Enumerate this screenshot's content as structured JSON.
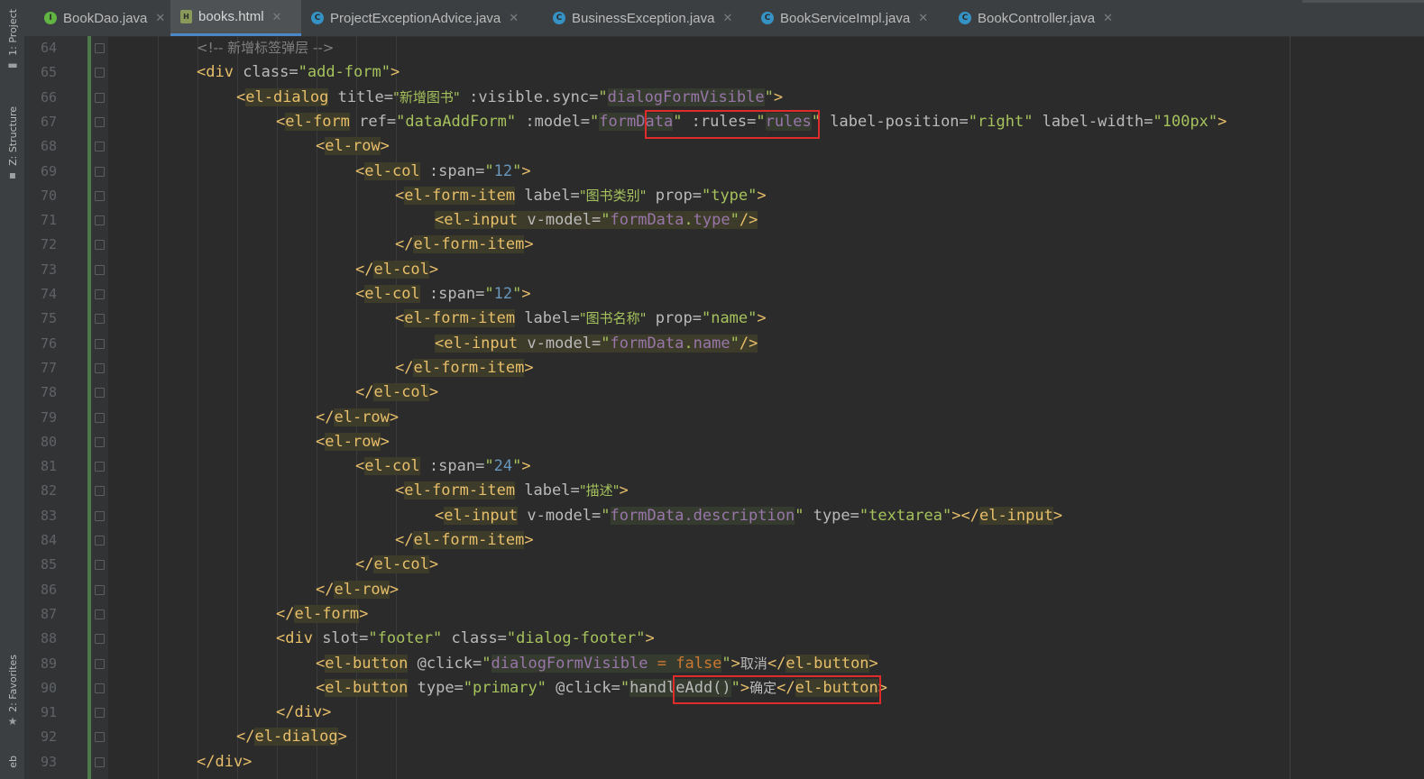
{
  "left_toolstrip": {
    "project": "1: Project",
    "structure": "Z: Structure",
    "favorites": "2: Favorites",
    "web": "eb"
  },
  "tabs": [
    {
      "label": "BookDao.java",
      "icon": "I",
      "icon_name": "interface-icon",
      "active": false
    },
    {
      "label": "books.html",
      "icon": "H",
      "icon_name": "html-file-icon",
      "active": true
    },
    {
      "label": "ProjectExceptionAdvice.java",
      "icon": "C",
      "icon_name": "class-icon",
      "active": false
    },
    {
      "label": "BusinessException.java",
      "icon": "C",
      "icon_name": "class-icon",
      "active": false
    },
    {
      "label": "BookServiceImpl.java",
      "icon": "C",
      "icon_name": "class-icon",
      "active": false
    },
    {
      "label": "BookController.java",
      "icon": "C",
      "icon_name": "class-icon",
      "active": false
    }
  ],
  "tab_close_glyph": "✕",
  "editor": {
    "line_numbers": [
      "64",
      "65",
      "66",
      "67",
      "68",
      "69",
      "70",
      "71",
      "72",
      "73",
      "74",
      "75",
      "76",
      "77",
      "78",
      "79",
      "80",
      "81",
      "82",
      "83",
      "84",
      "85",
      "86",
      "87",
      "88",
      "89",
      "90",
      "91",
      "92",
      "93"
    ],
    "lines": [
      {
        "indent": 0,
        "parts": [
          [
            "com",
            "<!-- 新增标签弹层 -->"
          ]
        ]
      },
      {
        "indent": 0,
        "parts": [
          [
            "tag",
            "<div "
          ],
          [
            "attr",
            "class="
          ],
          [
            "str",
            "\"add-form\""
          ],
          [
            "tag",
            ">"
          ]
        ]
      },
      {
        "indent": 1,
        "parts": [
          [
            "tag",
            "<"
          ],
          [
            "tag",
            "el-dialog",
            "hl"
          ],
          [
            "attr",
            " title="
          ],
          [
            "str",
            "\"新增图书\""
          ],
          [
            "attr",
            " :visible.sync="
          ],
          [
            "str",
            "\""
          ],
          [
            "var",
            "dialogFormVisible",
            "hl2"
          ],
          [
            "str",
            "\""
          ],
          [
            "tag",
            ">"
          ]
        ]
      },
      {
        "indent": 2,
        "parts": [
          [
            "tag",
            "<"
          ],
          [
            "tag",
            "el-form",
            "hl"
          ],
          [
            "attr",
            " ref="
          ],
          [
            "str",
            "\"dataAddForm\""
          ],
          [
            "attr",
            " :model="
          ],
          [
            "str",
            "\""
          ],
          [
            "var",
            "formData",
            "hl2"
          ],
          [
            "str",
            "\""
          ],
          [
            "attr",
            " :rules="
          ],
          [
            "str",
            "\""
          ],
          [
            "var",
            "rules",
            "hl2"
          ],
          [
            "str",
            "\""
          ],
          [
            "attr",
            " label-position="
          ],
          [
            "str",
            "\"right\""
          ],
          [
            "attr",
            " label-width="
          ],
          [
            "str",
            "\"100px\""
          ],
          [
            "tag",
            ">"
          ]
        ]
      },
      {
        "indent": 3,
        "parts": [
          [
            "tag",
            "<"
          ],
          [
            "tag",
            "el-row",
            "hl"
          ],
          [
            "tag",
            ">"
          ]
        ]
      },
      {
        "indent": 4,
        "parts": [
          [
            "tag",
            "<"
          ],
          [
            "tag",
            "el-col",
            "hl"
          ],
          [
            "attr",
            " :span="
          ],
          [
            "str",
            "\""
          ],
          [
            "num",
            "12"
          ],
          [
            "str",
            "\""
          ],
          [
            "tag",
            ">"
          ]
        ]
      },
      {
        "indent": 5,
        "parts": [
          [
            "tag",
            "<"
          ],
          [
            "tag",
            "el-form-item",
            "hl"
          ],
          [
            "attr",
            " label="
          ],
          [
            "str",
            "\"图书类别\""
          ],
          [
            "attr",
            " prop="
          ],
          [
            "str",
            "\"type\""
          ],
          [
            "tag",
            ">"
          ]
        ]
      },
      {
        "indent": 6,
        "parts": [
          [
            "tag",
            "<el-input",
            "hl"
          ],
          [
            "attr",
            " v-model=",
            "hl"
          ],
          [
            "str",
            "\"",
            "hl"
          ],
          [
            "var",
            "formData",
            "hl"
          ],
          [
            "str",
            ".",
            "hl"
          ],
          [
            "var",
            "type",
            "hl"
          ],
          [
            "str",
            "\"",
            "hl"
          ],
          [
            "tag",
            "/>",
            "hl"
          ]
        ]
      },
      {
        "indent": 5,
        "parts": [
          [
            "tag",
            "</"
          ],
          [
            "tag",
            "el-form-item",
            "hl"
          ],
          [
            "tag",
            ">"
          ]
        ]
      },
      {
        "indent": 4,
        "parts": [
          [
            "tag",
            "</"
          ],
          [
            "tag",
            "el-col",
            "hl"
          ],
          [
            "tag",
            ">"
          ]
        ]
      },
      {
        "indent": 4,
        "parts": [
          [
            "tag",
            "<"
          ],
          [
            "tag",
            "el-col",
            "hl"
          ],
          [
            "attr",
            " :span="
          ],
          [
            "str",
            "\""
          ],
          [
            "num",
            "12"
          ],
          [
            "str",
            "\""
          ],
          [
            "tag",
            ">"
          ]
        ]
      },
      {
        "indent": 5,
        "parts": [
          [
            "tag",
            "<"
          ],
          [
            "tag",
            "el-form-item",
            "hl"
          ],
          [
            "attr",
            " label="
          ],
          [
            "str",
            "\"图书名称\""
          ],
          [
            "attr",
            " prop="
          ],
          [
            "str",
            "\"name\""
          ],
          [
            "tag",
            ">"
          ]
        ]
      },
      {
        "indent": 6,
        "parts": [
          [
            "tag",
            "<el-input",
            "hl"
          ],
          [
            "attr",
            " v-model=",
            "hl"
          ],
          [
            "str",
            "\"",
            "hl"
          ],
          [
            "var",
            "formData",
            "hl"
          ],
          [
            "str",
            ".",
            "hl"
          ],
          [
            "var",
            "name",
            "hl"
          ],
          [
            "str",
            "\"",
            "hl"
          ],
          [
            "tag",
            "/>",
            "hl"
          ]
        ]
      },
      {
        "indent": 5,
        "parts": [
          [
            "tag",
            "</"
          ],
          [
            "tag",
            "el-form-item",
            "hl"
          ],
          [
            "tag",
            ">"
          ]
        ]
      },
      {
        "indent": 4,
        "parts": [
          [
            "tag",
            "</"
          ],
          [
            "tag",
            "el-col",
            "hl"
          ],
          [
            "tag",
            ">"
          ]
        ]
      },
      {
        "indent": 3,
        "parts": [
          [
            "tag",
            "</"
          ],
          [
            "tag",
            "el-row",
            "hl"
          ],
          [
            "tag",
            ">"
          ]
        ]
      },
      {
        "indent": 3,
        "parts": [
          [
            "tag",
            "<"
          ],
          [
            "tag",
            "el-row",
            "hl"
          ],
          [
            "tag",
            ">"
          ]
        ]
      },
      {
        "indent": 4,
        "parts": [
          [
            "tag",
            "<"
          ],
          [
            "tag",
            "el-col",
            "hl"
          ],
          [
            "attr",
            " :span="
          ],
          [
            "str",
            "\""
          ],
          [
            "num",
            "24"
          ],
          [
            "str",
            "\""
          ],
          [
            "tag",
            ">"
          ]
        ]
      },
      {
        "indent": 5,
        "parts": [
          [
            "tag",
            "<"
          ],
          [
            "tag",
            "el-form-item",
            "hl"
          ],
          [
            "attr",
            " label="
          ],
          [
            "str",
            "\"描述\""
          ],
          [
            "tag",
            ">"
          ]
        ]
      },
      {
        "indent": 6,
        "parts": [
          [
            "tag",
            "<"
          ],
          [
            "tag",
            "el-input",
            "hl"
          ],
          [
            "attr",
            " v-model="
          ],
          [
            "str",
            "\""
          ],
          [
            "var",
            "formData.description",
            "hl2"
          ],
          [
            "str",
            "\""
          ],
          [
            "attr",
            " type="
          ],
          [
            "str",
            "\"textarea\""
          ],
          [
            "tag",
            "></"
          ],
          [
            "tag",
            "el-input",
            "hl"
          ],
          [
            "tag",
            ">"
          ]
        ]
      },
      {
        "indent": 5,
        "parts": [
          [
            "tag",
            "</"
          ],
          [
            "tag",
            "el-form-item",
            "hl"
          ],
          [
            "tag",
            ">"
          ]
        ]
      },
      {
        "indent": 4,
        "parts": [
          [
            "tag",
            "</"
          ],
          [
            "tag",
            "el-col",
            "hl"
          ],
          [
            "tag",
            ">"
          ]
        ]
      },
      {
        "indent": 3,
        "parts": [
          [
            "tag",
            "</"
          ],
          [
            "tag",
            "el-row",
            "hl"
          ],
          [
            "tag",
            ">"
          ]
        ]
      },
      {
        "indent": 2,
        "parts": [
          [
            "tag",
            "</"
          ],
          [
            "tag",
            "el-form",
            "hl"
          ],
          [
            "tag",
            ">"
          ]
        ]
      },
      {
        "indent": 2,
        "parts": [
          [
            "tag",
            "<div "
          ],
          [
            "attr",
            "slot="
          ],
          [
            "str",
            "\"footer\""
          ],
          [
            "attr",
            " class="
          ],
          [
            "str",
            "\"dialog-footer\""
          ],
          [
            "tag",
            ">"
          ]
        ]
      },
      {
        "indent": 3,
        "parts": [
          [
            "tag",
            "<"
          ],
          [
            "tag",
            "el-button",
            "hl"
          ],
          [
            "attr",
            " @click="
          ],
          [
            "str",
            "\""
          ],
          [
            "var",
            "dialogFormVisible",
            "hl2"
          ],
          [
            "kw",
            " = ",
            "hl2"
          ],
          [
            "kw",
            "false",
            "hl2"
          ],
          [
            "str",
            "\""
          ],
          [
            "tag",
            ">"
          ],
          [
            "attr",
            "取消"
          ],
          [
            "tag",
            "</"
          ],
          [
            "tag",
            "el-button",
            "hl"
          ],
          [
            "tag",
            ">"
          ]
        ]
      },
      {
        "indent": 3,
        "parts": [
          [
            "tag",
            "<"
          ],
          [
            "tag",
            "el-button",
            "hl"
          ],
          [
            "attr",
            " type="
          ],
          [
            "str",
            "\"primary\""
          ],
          [
            "attr",
            " @click="
          ],
          [
            "str",
            "\""
          ],
          [
            "attr",
            "handleAdd()",
            "hl2"
          ],
          [
            "str",
            "\""
          ],
          [
            "tag",
            ">"
          ],
          [
            "attr",
            "确定"
          ],
          [
            "tag",
            "</"
          ],
          [
            "tag",
            "el-button",
            "hl"
          ],
          [
            "tag",
            ">"
          ]
        ]
      },
      {
        "indent": 2,
        "parts": [
          [
            "tag",
            "</div>"
          ]
        ]
      },
      {
        "indent": 1,
        "parts": [
          [
            "tag",
            "</"
          ],
          [
            "tag",
            "el-dialog",
            "hl"
          ],
          [
            "tag",
            ">"
          ]
        ]
      },
      {
        "indent": 0,
        "parts": [
          [
            "tag",
            "</div>"
          ]
        ]
      }
    ]
  },
  "colors": {
    "editor_bg": "#2b2b2b",
    "tag": "#e8bf6a",
    "string": "#a5c25c",
    "comment": "#808080",
    "variable": "#9876aa",
    "number": "#6897bb",
    "keyword": "#cc7832",
    "annotation_box": "#e02b2b"
  }
}
